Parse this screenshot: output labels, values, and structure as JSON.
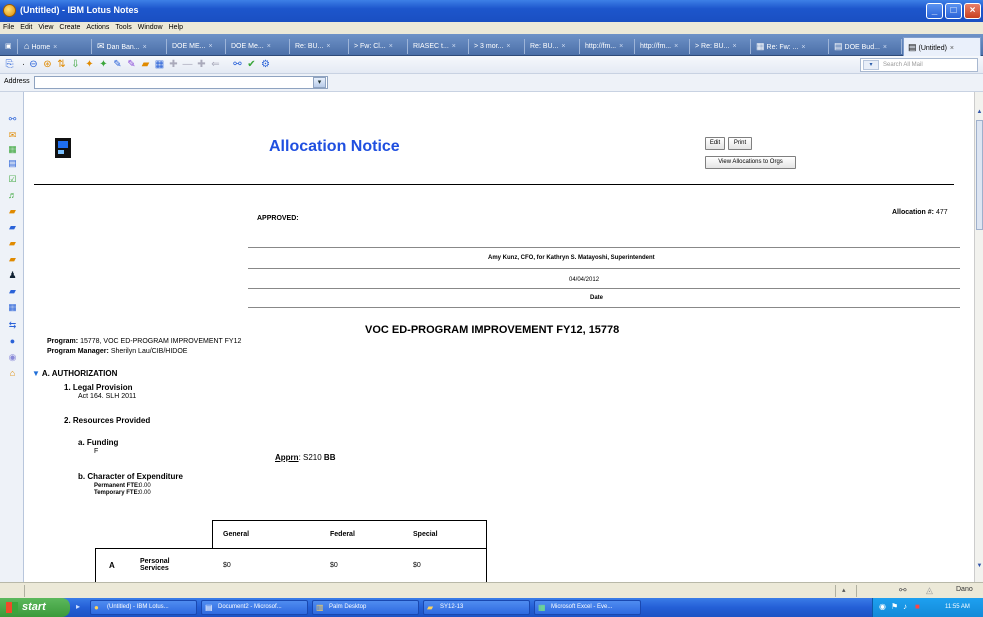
{
  "window": {
    "title": "(Untitled) - IBM Lotus Notes"
  },
  "menu": [
    "File",
    "Edit",
    "View",
    "Create",
    "Actions",
    "Tools",
    "Window",
    "Help"
  ],
  "tabs": [
    {
      "label": "Home",
      "icon": "home-icon"
    },
    {
      "label": "Dan Ban...",
      "icon": "mail-icon"
    },
    {
      "label": "DOE ME...",
      "icon": ""
    },
    {
      "label": "DOE Me...",
      "icon": ""
    },
    {
      "label": "Re: BU...",
      "icon": ""
    },
    {
      "label": "> Fw: Cl...",
      "icon": ""
    },
    {
      "label": "RIASEC t...",
      "icon": ""
    },
    {
      "label": "> 3 mor...",
      "icon": ""
    },
    {
      "label": "Re: BU...",
      "icon": ""
    },
    {
      "label": "http://fm...",
      "icon": ""
    },
    {
      "label": "http://fm...",
      "icon": ""
    },
    {
      "label": "> Re: BU...",
      "icon": ""
    },
    {
      "label": "Re: Fw: ...",
      "icon": "calendar-icon"
    },
    {
      "label": "DOE Bud...",
      "icon": "database-icon"
    },
    {
      "label": "(Untitled)",
      "icon": "database-icon"
    }
  ],
  "search": {
    "placeholder": "Search All Mail"
  },
  "address": {
    "label": "Address",
    "value": ""
  },
  "document": {
    "heading": "Allocation Notice",
    "buttons": {
      "edit": "Edit",
      "print": "Print",
      "view_allocations": "View Allocations to Orgs"
    },
    "approved_label": "APPROVED:",
    "allocation_label": "Allocation #:",
    "allocation_number": "477",
    "signer": "Amy Kunz, CFO, for Kathryn S. Matayoshi, Superintendent",
    "date_value": "04/04/2012",
    "date_label": "Date",
    "program_title": "VOC ED-PROGRAM IMPROVEMENT FY12,  15778",
    "program_label": "Program:",
    "program_value": "15778, VOC ED-PROGRAM IMPROVEMENT FY12",
    "manager_label": "Program Manager:",
    "manager_value": "Sherilyn Lau/CIB/HIDOE",
    "section_a": "A. AUTHORIZATION",
    "item1_title": "1.  Legal Provision",
    "item1_value": "Act 164. SLH 2011",
    "item2_title": "2.  Resources Provided",
    "funding_title": "a.  Funding",
    "funding_value": "F",
    "apprn_label": "Apprn",
    "apprn_value": ": S210 ",
    "apprn_bold": "BB",
    "coe_title": "b.  Character of Expenditure",
    "perm_label": "Permanent FTE:",
    "perm_value": "0.00",
    "temp_label": "Temporary FTE:",
    "temp_value": "0.00",
    "table": {
      "headers": [
        "General",
        "Federal",
        "Special"
      ],
      "row_letter": "A",
      "row_label": "Personal Services",
      "values": [
        "$0",
        "$0",
        "$0"
      ]
    }
  },
  "statusbar": {
    "user": "Dano"
  },
  "taskbar": {
    "start": "start",
    "items": [
      {
        "label": "(Untitled) - IBM Lotus...",
        "icon": "lotus-icon"
      },
      {
        "label": "Document2 - Microsof...",
        "icon": "word-icon"
      },
      {
        "label": "Palm Desktop",
        "icon": "palm-icon"
      },
      {
        "label": "SY12-13",
        "icon": "folder-icon"
      },
      {
        "label": "Microsoft Excel - Eve...",
        "icon": "excel-icon"
      }
    ],
    "clock": "11:55 AM"
  }
}
